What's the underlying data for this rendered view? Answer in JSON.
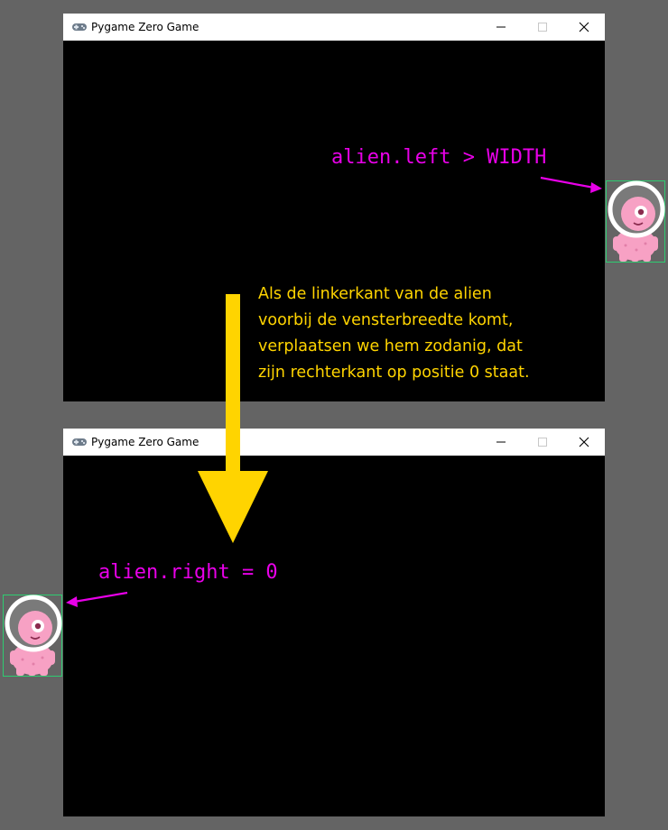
{
  "windows": [
    {
      "title": "Pygame Zero Game"
    },
    {
      "title": "Pygame Zero Game"
    }
  ],
  "annotations": {
    "top_code": "alien.left > WIDTH",
    "bottom_code": "alien.right = 0",
    "explanation": [
      "Als de linkerkant van de alien",
      "voorbij de vensterbreedte komt,",
      "verplaatsen we hem zodanig, dat",
      "zijn rechterkant op positie 0 staat."
    ]
  },
  "colors": {
    "background": "#646464",
    "window": "#000000",
    "code_text": "#e800e8",
    "explanation_text": "#ffd400",
    "arrow": "#ffd400",
    "pointer_arrow": "#e800e8",
    "bounding_box": "#2ecc71",
    "alien_body": "#f7a1c4"
  },
  "icons": [
    "gamepad-icon",
    "minimize-icon",
    "maximize-icon",
    "close-icon",
    "alien-sprite"
  ]
}
